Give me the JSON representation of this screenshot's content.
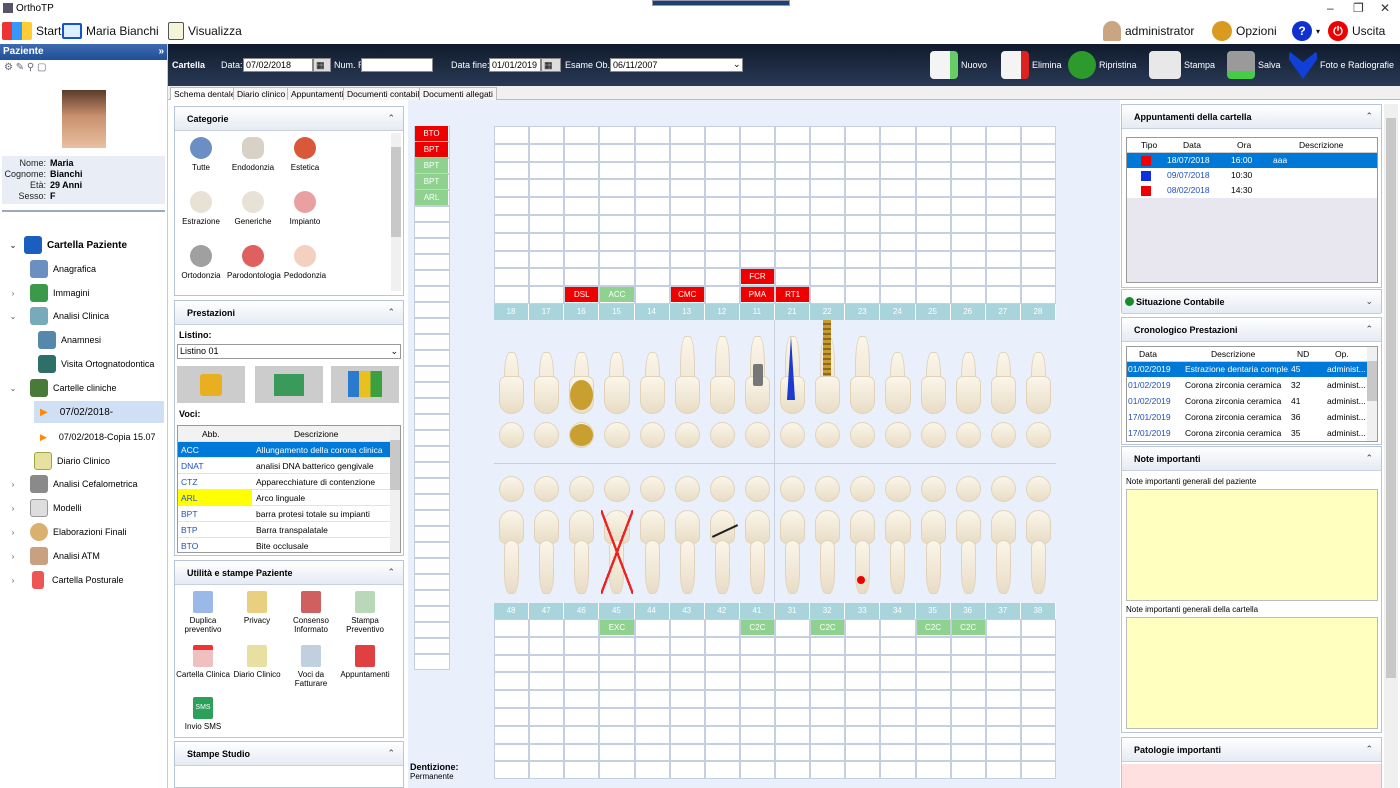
{
  "window": {
    "title": "OrthoTP"
  },
  "toolbar": {
    "start": "Start",
    "patient": "Maria Bianchi",
    "visualizza": "Visualizza",
    "user": "administrator",
    "opzioni": "Opzioni",
    "uscita": "Uscita"
  },
  "left": {
    "header": "Paziente",
    "nome_k": "Nome:",
    "nome": "Maria",
    "cognome_k": "Cognome:",
    "cognome": "Bianchi",
    "eta_k": "Età:",
    "eta": "29 Anni",
    "sesso_k": "Sesso:",
    "sesso": "F",
    "tree": [
      "Cartella Paziente",
      "Anagrafica",
      "Immagini",
      "Analisi Clinica",
      "Anamnesi",
      "Visita Ortognatodontica",
      "Cartelle cliniche",
      "07/02/2018-",
      "07/02/2018-Copia 15.07",
      "Diario Clinico",
      "Analisi Cefalometrica",
      "Modelli",
      "Elaborazioni Finali",
      "Analisi ATM",
      "Cartella Posturale"
    ]
  },
  "header": {
    "cartella": "Cartella",
    "data_lbl": "Data:",
    "data": "07/02/2018",
    "numrif_lbl": "Num. Rif.:",
    "datafine_lbl": "Data fine:",
    "datafine": "01/01/2019",
    "esame_lbl": "Esame Ob.:",
    "esame": "06/11/2007",
    "nuovo": "Nuovo",
    "elimina": "Elimina",
    "ripristina": "Ripristina",
    "stampa": "Stampa",
    "salva": "Salva",
    "foto": "Foto e Radiografie"
  },
  "tabs": [
    "Schema dentale",
    "Diario clinico",
    "Appuntamenti",
    "Documenti contabili",
    "Documenti allegati"
  ],
  "categorie": {
    "title": "Categorie",
    "items": [
      "Tutte",
      "Endodonzia",
      "Estetica",
      "Estrazione",
      "Generiche",
      "Impianto",
      "Ortodonzia",
      "Parodontologia",
      "Pedodonzia"
    ]
  },
  "prestazioni": {
    "title": "Prestazioni",
    "listino_lbl": "Listino:",
    "listino": "Listino 01",
    "voci_lbl": "Voci:",
    "col_abb": "Abb.",
    "col_desc": "Descrizione",
    "rows": [
      [
        "ACC",
        "Allungamento della corona clinica"
      ],
      [
        "DNAT",
        "analisi DNA batterico gengivale"
      ],
      [
        "CTZ",
        "Apparecchiature di contenzione"
      ],
      [
        "ARL",
        "Arco linguale"
      ],
      [
        "BPT",
        "barra protesi totale su impianti"
      ],
      [
        "BTP",
        "Barra transpalatale"
      ],
      [
        "BTO",
        "Bite occlusale"
      ]
    ]
  },
  "utilita": {
    "title": "Utilità e stampe Paziente",
    "items": [
      "Duplica preventivo",
      "Privacy",
      "Consenso Informato",
      "Stampa Preventivo",
      "Cartella Clinica",
      "Diario Clinico",
      "Voci da Fatturare",
      "Appuntamenti",
      "Invio SMS"
    ]
  },
  "stampe": {
    "title": "Stampe Studio"
  },
  "chart": {
    "side_tags": [
      "BTO",
      "BPT",
      "BPT",
      "BPT",
      "ARL"
    ],
    "upper_nums": [
      "18",
      "17",
      "16",
      "15",
      "14",
      "13",
      "12",
      "11",
      "21",
      "22",
      "23",
      "24",
      "25",
      "26",
      "27",
      "28"
    ],
    "lower_nums": [
      "48",
      "47",
      "46",
      "45",
      "44",
      "43",
      "42",
      "41",
      "31",
      "32",
      "33",
      "34",
      "35",
      "36",
      "37",
      "38"
    ],
    "upper_tags": [
      {
        "t": "DSL",
        "col": 2,
        "c": "#e00"
      },
      {
        "t": "ACC",
        "col": 3,
        "c": "#8fd28f"
      },
      {
        "t": "CMC",
        "col": 5,
        "c": "#e00"
      },
      {
        "t": "PMA",
        "col": 7,
        "c": "#e00"
      },
      {
        "t": "RT1",
        "col": 8,
        "c": "#e00"
      }
    ],
    "fcr": "FCR",
    "lower_tags": [
      {
        "t": "EXC",
        "col": 3
      },
      {
        "t": "C2C",
        "col": 7
      },
      {
        "t": "C2C",
        "col": 9
      },
      {
        "t": "C2C",
        "col": 12
      },
      {
        "t": "C2C",
        "col": 13
      }
    ],
    "dentizione_lbl": "Dentizione:",
    "dentizione": "Permanente"
  },
  "appuntamenti": {
    "title": "Appuntamenti della cartella",
    "cols": [
      "Tipo",
      "Data",
      "Ora",
      "Descrizione"
    ],
    "rows": [
      {
        "color": "#e00",
        "data": "18/07/2018",
        "ora": "16:00",
        "desc": "aaa"
      },
      {
        "color": "#1030e0",
        "data": "09/07/2018",
        "ora": "10:30",
        "desc": ""
      },
      {
        "color": "#e00",
        "data": "08/02/2018",
        "ora": "14:30",
        "desc": ""
      }
    ]
  },
  "situazione": {
    "title": "Situazione Contabile"
  },
  "cronologico": {
    "title": "Cronologico Prestazioni",
    "cols": [
      "Data",
      "Descrizione",
      "ND",
      "Op."
    ],
    "rows": [
      [
        "01/02/2019",
        "Estrazione dentaria comple...",
        "45",
        "administ..."
      ],
      [
        "01/02/2019",
        "Corona zirconia ceramica",
        "32",
        "administ..."
      ],
      [
        "01/02/2019",
        "Corona zirconia ceramica",
        "41",
        "administ..."
      ],
      [
        "17/01/2019",
        "Corona zirconia ceramica",
        "36",
        "administ..."
      ],
      [
        "17/01/2019",
        "Corona zirconia ceramica",
        "35",
        "administ..."
      ]
    ]
  },
  "note": {
    "title": "Note importanti",
    "paziente_lbl": "Note importanti generali del paziente",
    "cartella_lbl": "Note importanti generali della cartella"
  },
  "patologie": {
    "title": "Patologie importanti"
  }
}
